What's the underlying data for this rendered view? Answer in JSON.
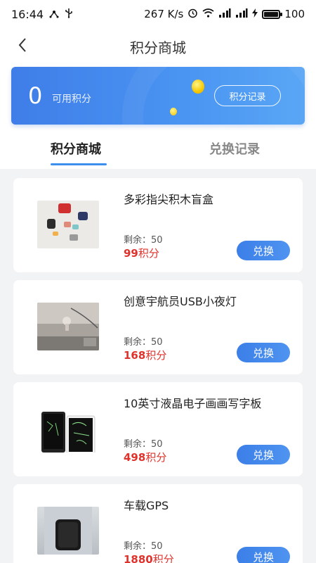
{
  "status_bar": {
    "time": "16:44",
    "net_speed": "267 K/s",
    "battery": "100"
  },
  "nav": {
    "title": "积分商城"
  },
  "points_card": {
    "value": "0",
    "label": "可用积分",
    "records_button": "积分记录"
  },
  "tabs": [
    {
      "label": "积分商城",
      "active": true
    },
    {
      "label": "兑换记录",
      "active": false
    }
  ],
  "products": [
    {
      "name": "多彩指尖积木盲盒",
      "stock": "剩余：50",
      "price": "99",
      "unit": "积分",
      "button": "兑换",
      "image_icon": "building-blocks"
    },
    {
      "name": "创意宇航员USB小夜灯",
      "stock": "剩余：50",
      "price": "168",
      "unit": "积分",
      "button": "兑换",
      "image_icon": "night-lamp"
    },
    {
      "name": "10英寸液晶电子画画写字板",
      "stock": "剩余：50",
      "price": "498",
      "unit": "积分",
      "button": "兑换",
      "image_icon": "lcd-tablet"
    },
    {
      "name": "车载GPS",
      "stock": "剩余：50",
      "price": "1880",
      "unit": "积分",
      "button": "兑换",
      "image_icon": "gps-device"
    }
  ],
  "colors": {
    "accent": "#3d8fee",
    "price": "#e0322c",
    "card_gradient_start": "#3f7de8",
    "card_gradient_end": "#5aa6f5"
  }
}
